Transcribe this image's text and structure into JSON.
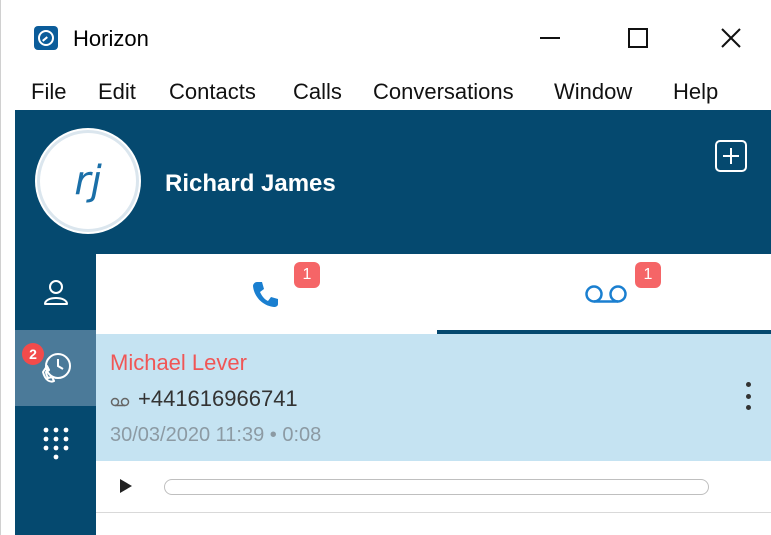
{
  "window": {
    "title": "Horizon",
    "icon": "horizon-app-icon",
    "controls": [
      "minimize-icon",
      "maximize-icon",
      "close-icon"
    ]
  },
  "menubar": {
    "items": [
      {
        "label": "File"
      },
      {
        "label": "Edit"
      },
      {
        "label": "Contacts"
      },
      {
        "label": "Calls"
      },
      {
        "label": "Conversations"
      },
      {
        "label": "Window"
      },
      {
        "label": "Help"
      }
    ]
  },
  "header": {
    "avatar_initials": "rj",
    "user_name": "Richard James",
    "add_icon": "plus-square-icon"
  },
  "sidebar": {
    "items": [
      {
        "name": "contacts",
        "icon": "person-icon"
      },
      {
        "name": "history",
        "icon": "phone-history-icon",
        "badge": "2"
      },
      {
        "name": "dialpad",
        "icon": "dialpad-icon"
      }
    ]
  },
  "tabs": [
    {
      "name": "calls",
      "icon": "phone-icon",
      "badge": "1"
    },
    {
      "name": "voicemail",
      "icon": "voicemail-icon",
      "badge": "1",
      "selected": true
    }
  ],
  "voicemail_item": {
    "caller_name": "Michael Lever",
    "number": "+441616966741",
    "meta": "30/03/2020 11:39 • 0:08"
  },
  "player": {
    "progress": 0
  },
  "colors": {
    "brand_dark": "#05496f",
    "selected_side": "#4b7a99",
    "list_bg": "#c5e3f2",
    "caller_name": "#f05656",
    "badge": "#f56567",
    "icon_blue": "#1a7fd0"
  }
}
